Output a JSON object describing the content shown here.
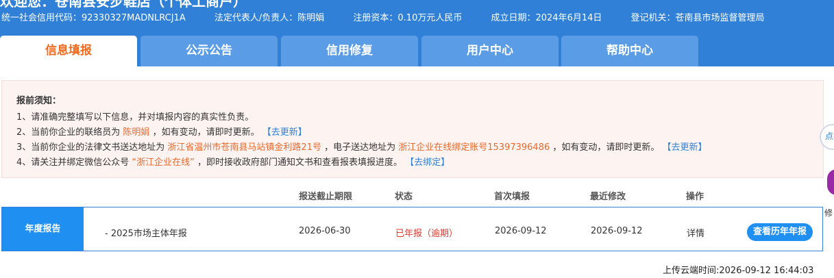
{
  "header": {
    "greeting": "欢迎您：苍南县安步鞋店（个体工商户）",
    "credit_code": "统一社会信用代码：92330327MADNLRCJ1A",
    "legal_rep": "法定代表人/负责人：陈明娟",
    "capital": "注册资本：0.10万元人民币",
    "established": "成立日期：2024年6月14日",
    "authority": "登记机关：苍南县市场监督管理局"
  },
  "tabs": [
    {
      "label": "信息填报",
      "active": true
    },
    {
      "label": "公示公告",
      "active": false
    },
    {
      "label": "信用修复",
      "active": false
    },
    {
      "label": "用户中心",
      "active": false
    },
    {
      "label": "帮助中心",
      "active": false
    }
  ],
  "notice": {
    "title": "报前须知：",
    "line1": "1、请准确完整填写以下信息，并对填报内容的真实性负责。",
    "line2_prefix": "2、当前你企业的联络员为",
    "line2_name": "陈明娟",
    "line2_suffix": "，如有变动，请即时更新。",
    "line2_link": "【去更新】",
    "line3_prefix": "3、当前你企业的法律文书送达地址为",
    "line3_address": "浙江省温州市苍南县马站镇金利路21号",
    "line3_mid": "，电子送达地址为",
    "line3_eaddress": "浙江企业在线绑定账号15397396486",
    "line3_suffix": "，如有变动，请即时更新。",
    "line3_link": "【去更新】",
    "line4_prefix": "4、请关注并绑定微信公众号",
    "line4_account": "“浙江企业在线”",
    "line4_suffix": "，即时接收政府部门通知文书和查看报表填报进度。",
    "line4_link": "【去绑定】"
  },
  "float": {
    "a": "点我",
    "c": "修"
  },
  "table": {
    "headers": [
      "报送截止期限",
      "状态",
      "首次填报",
      "最近修改",
      "操作"
    ],
    "row": {
      "label": "年度报告",
      "name": "- 2025市场主体年报",
      "deadline": "2026-06-30",
      "status": "已年报（逾期）",
      "first_filed": "2026-09-12",
      "last_modified": "2026-09-12",
      "detail_link": "详情",
      "history_button": "查看历年年报"
    }
  },
  "upload_time": "上传云端时间:2026-09-12 16:44:03",
  "colors": {
    "header_blue": "#2f80d6",
    "tab_blue": "#5a9ce6",
    "active_tab_text": "#f06a1e",
    "highlight_orange": "#e9692c",
    "status_red": "#e2372c",
    "button_blue": "#1f8ff2"
  }
}
